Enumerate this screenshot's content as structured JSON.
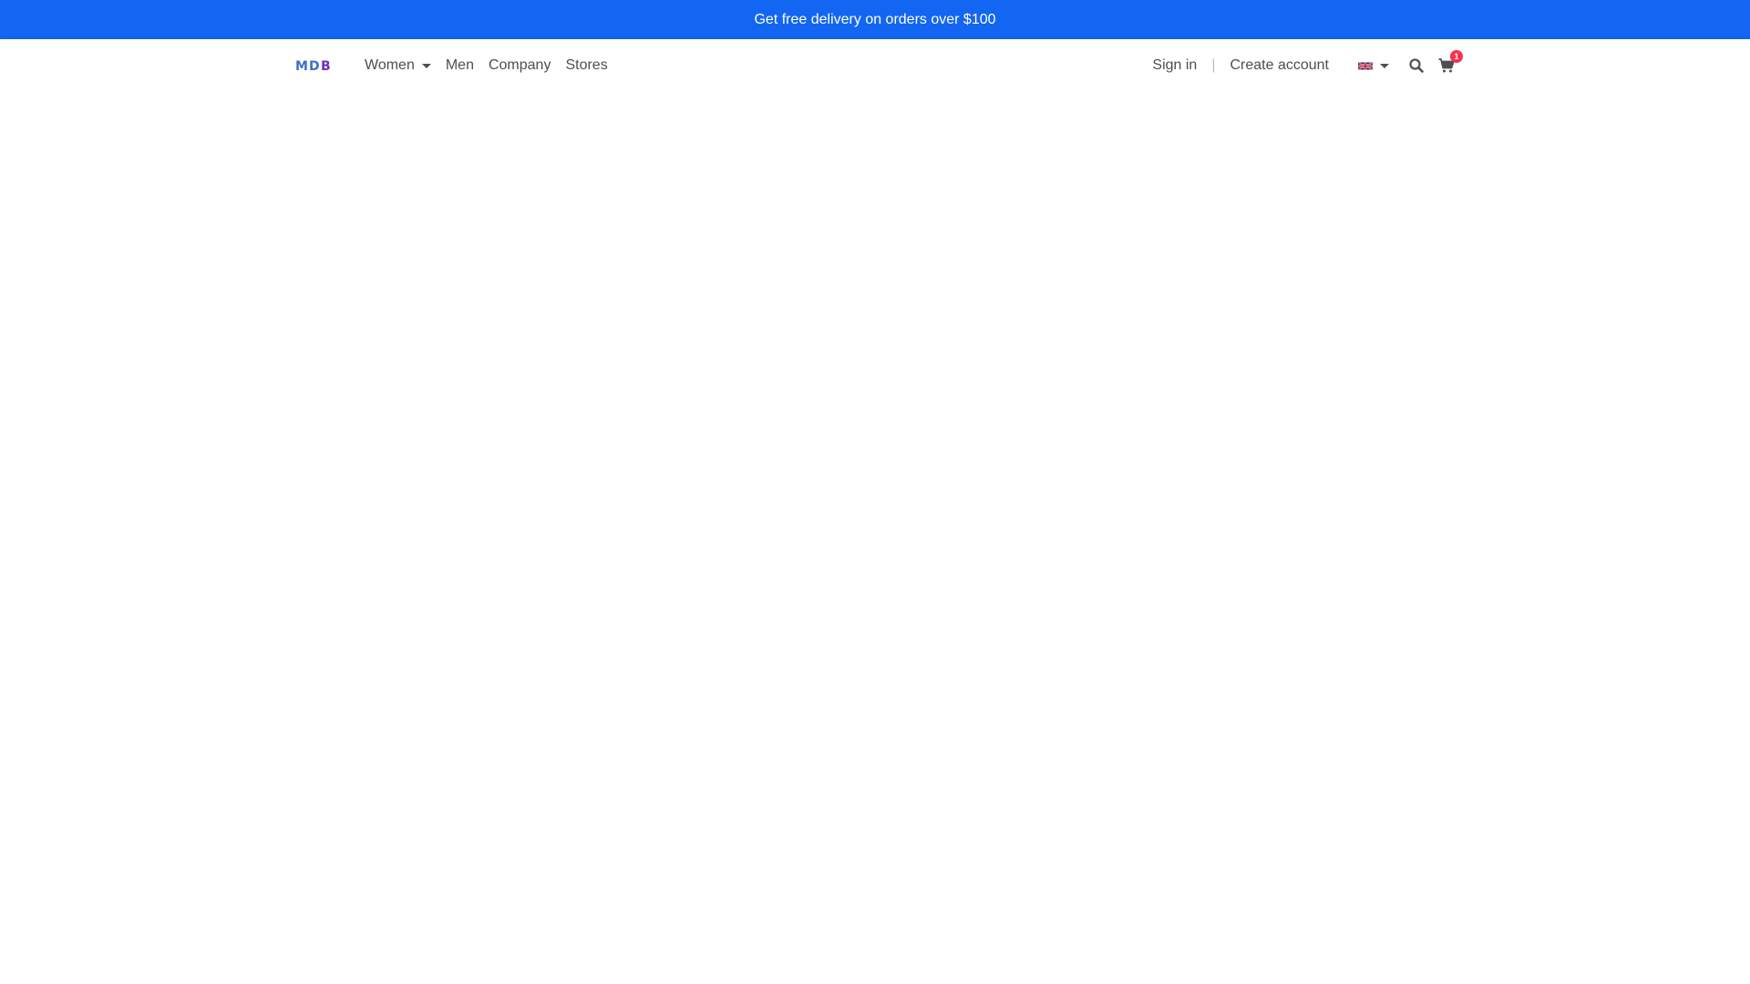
{
  "promo": {
    "text": "Get free delivery on orders over $100"
  },
  "brand": {
    "logo_text": "MDB",
    "colors": {
      "m": "#3b71ca",
      "d": "#3b71ca",
      "b": "#6a2fbd"
    }
  },
  "nav": {
    "items": [
      {
        "label": "Women",
        "has_dropdown": true
      },
      {
        "label": "Men",
        "has_dropdown": false
      },
      {
        "label": "Company",
        "has_dropdown": false
      },
      {
        "label": "Stores",
        "has_dropdown": false
      }
    ]
  },
  "account": {
    "sign_in": "Sign in",
    "divider": "|",
    "create_account": "Create account"
  },
  "language": {
    "icon": "uk-flag-icon"
  },
  "search": {
    "icon": "search-icon"
  },
  "cart": {
    "icon": "cart-icon",
    "count": "1"
  },
  "colors": {
    "primary": "#1266f1",
    "badge": "#f93154",
    "text": "#4f4f4f"
  }
}
